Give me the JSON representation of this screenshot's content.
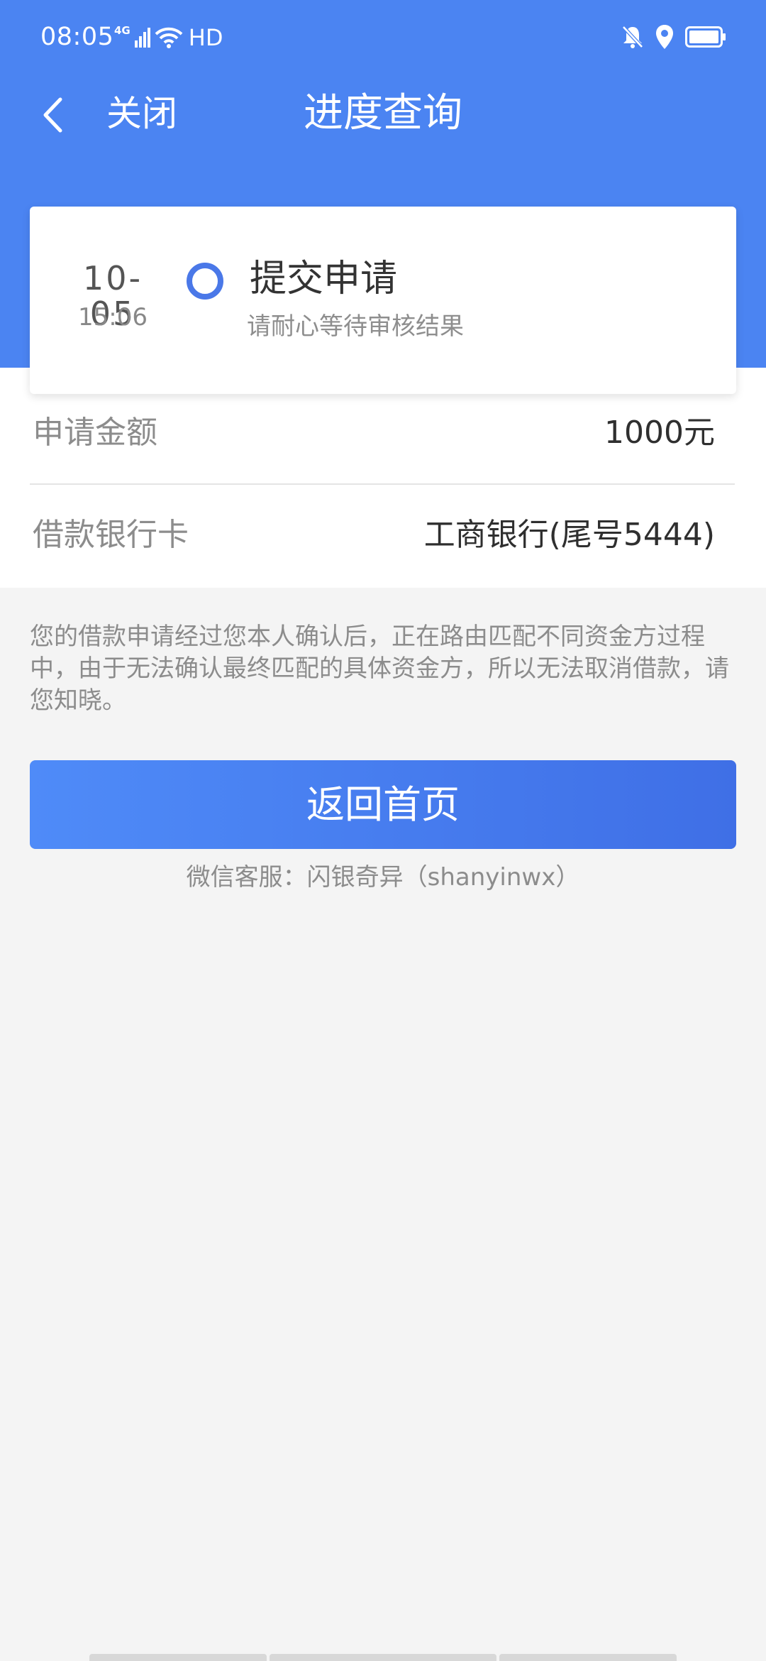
{
  "status_bar": {
    "time": "08:05",
    "network": "4G",
    "hd": "HD",
    "icons": [
      "signal-icon",
      "wifi-icon",
      "mute-icon",
      "location-icon",
      "battery-icon"
    ]
  },
  "nav": {
    "back_icon": "chevron-left-icon",
    "close_label": "关闭",
    "title": "进度查询"
  },
  "progress": {
    "date": "10-05",
    "time": "15:06",
    "status": "提交申请",
    "hint": "请耐心等待审核结果"
  },
  "info": {
    "amount_label": "申请金额",
    "amount_value": "1000元",
    "bank_label": "借款银行卡",
    "bank_value": "工商银行(尾号5444)"
  },
  "notice": "您的借款申请经过您本人确认后，正在路由匹配不同资金方过程中，由于无法确认最终匹配的具体资金方，所以无法取消借款，请您知晓。",
  "home_button": "返回首页",
  "support": "微信客服：闪银奇异（shanyinwx）",
  "colors": {
    "primary": "#4b84f2",
    "button_start": "#4f8bf8",
    "button_end": "#3f6fe6",
    "background": "#f4f4f4"
  }
}
